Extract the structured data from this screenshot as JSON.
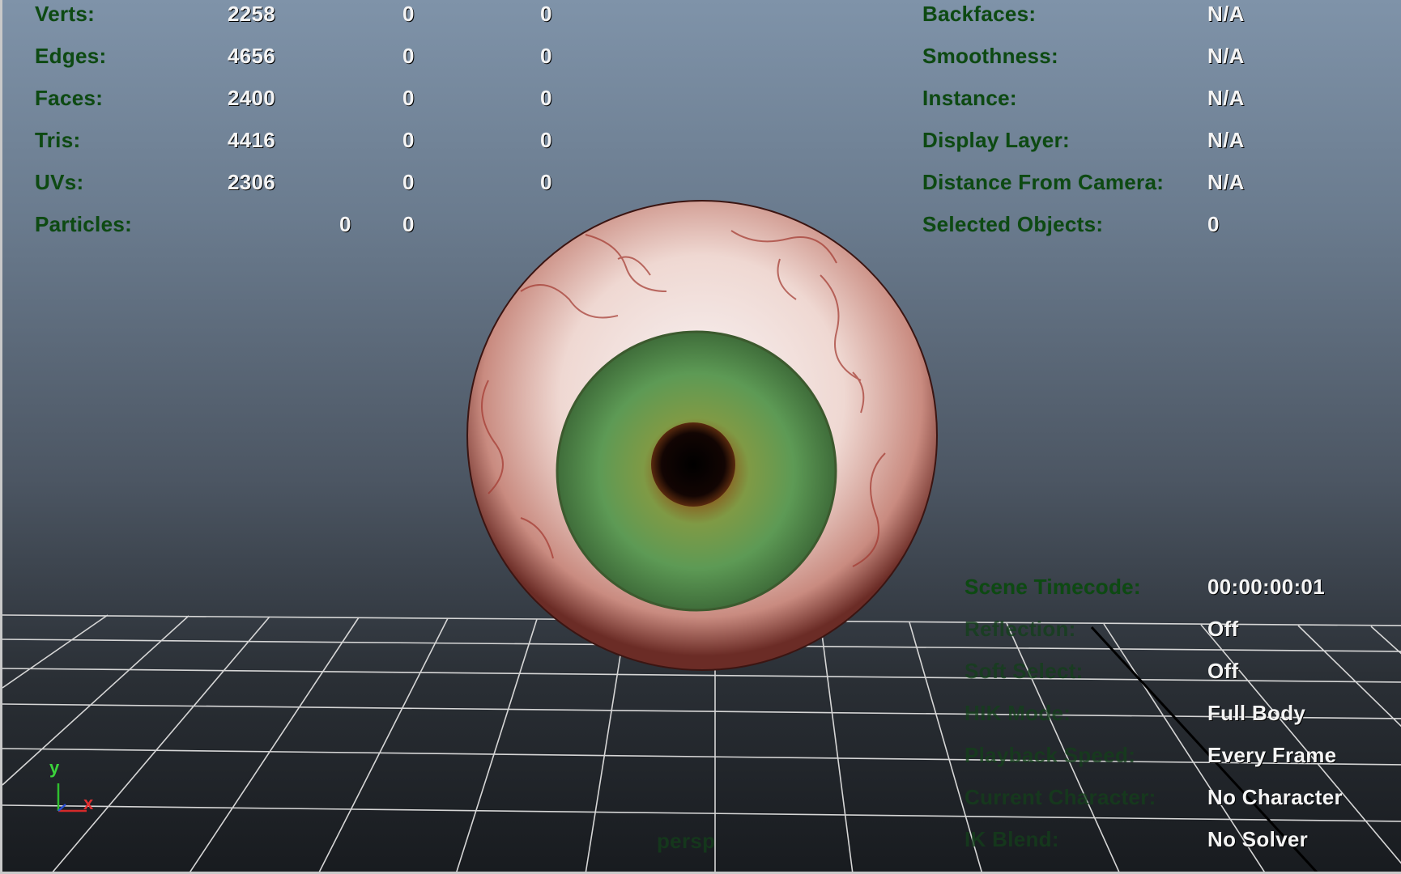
{
  "stats": [
    {
      "label": "Verts:",
      "a": "2258",
      "b": "0",
      "c": "0"
    },
    {
      "label": "Edges:",
      "a": "4656",
      "b": "0",
      "c": "0"
    },
    {
      "label": "Faces:",
      "a": "2400",
      "b": "0",
      "c": "0"
    },
    {
      "label": "Tris:",
      "a": "4416",
      "b": "0",
      "c": "0"
    },
    {
      "label": "UVs:",
      "a": "2306",
      "b": "0",
      "c": "0"
    }
  ],
  "particles": {
    "label": "Particles:",
    "a": "0",
    "b": "0"
  },
  "right_info": [
    {
      "label": "Backfaces:",
      "value": "N/A"
    },
    {
      "label": "Smoothness:",
      "value": "N/A"
    },
    {
      "label": "Instance:",
      "value": "N/A"
    },
    {
      "label": "Display Layer:",
      "value": "N/A"
    },
    {
      "label": "Distance From Camera:",
      "value": "N/A"
    },
    {
      "label": "Selected Objects:",
      "value": "0"
    }
  ],
  "bottom_info": [
    {
      "label": "Scene Timecode:",
      "value": "00:00:00:01"
    },
    {
      "label": "Reflection:",
      "value": "Off"
    },
    {
      "label": "Soft Select:",
      "value": "Off"
    },
    {
      "label": "HIK Mode:",
      "value": "Full Body"
    },
    {
      "label": "Playback Speed:",
      "value": "Every Frame"
    },
    {
      "label": "Current Character:",
      "value": "No Character"
    },
    {
      "label": "IK Blend:",
      "value": "No Solver"
    }
  ],
  "camera_label": "persp",
  "axis": {
    "y": "y",
    "x": "x"
  },
  "colors": {
    "hud_label": "#0d4a12",
    "iris": "#5f9a4f",
    "sclera": "#f1ddd6"
  }
}
